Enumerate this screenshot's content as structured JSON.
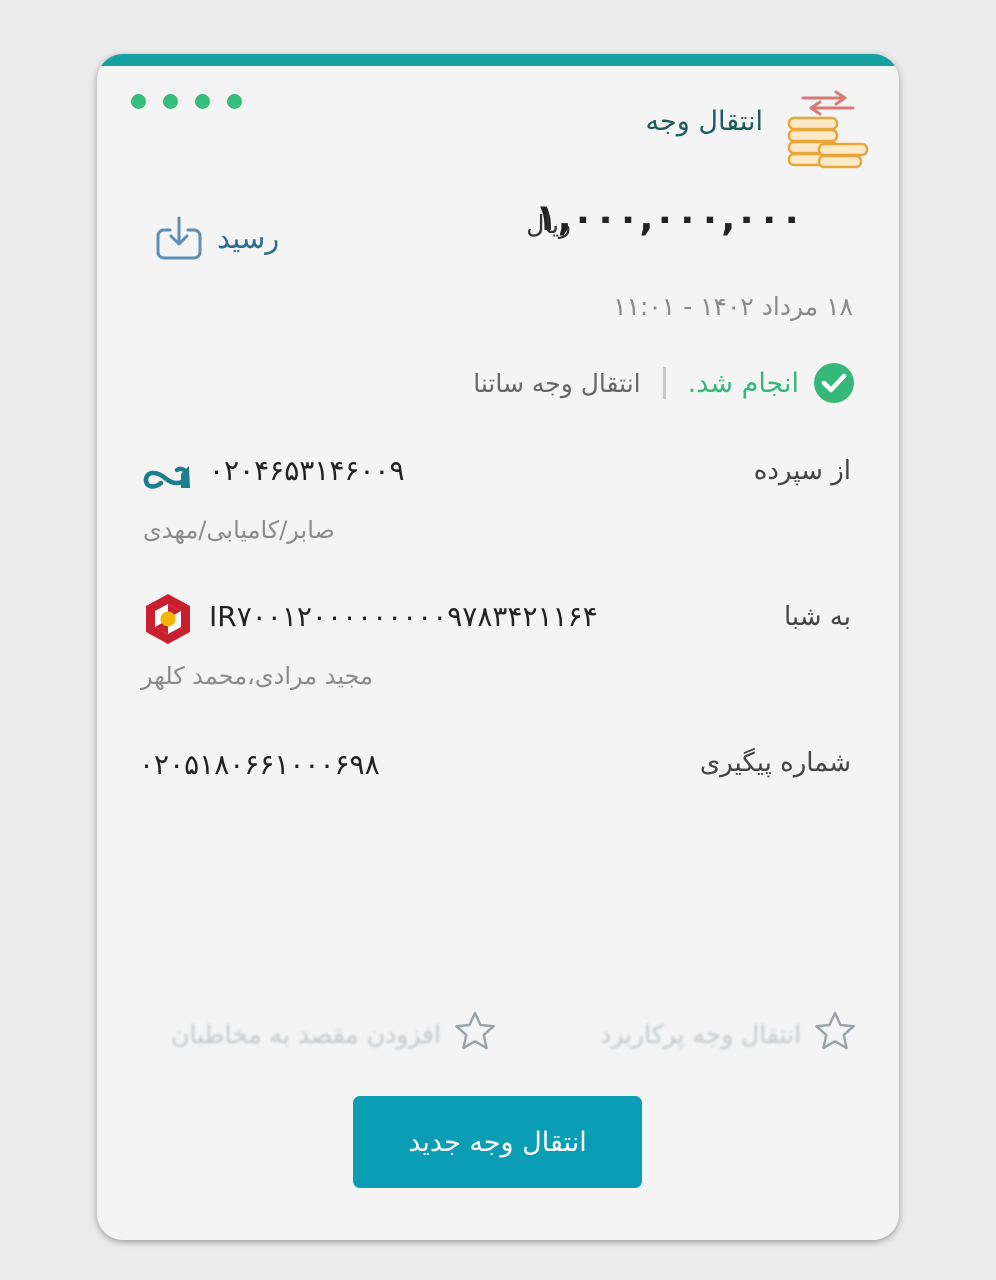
{
  "header": {
    "title": "انتقال وجه",
    "dot_count": 4
  },
  "transaction": {
    "amount": "۱,۰۰۰,۰۰۰,۰۰۰",
    "currency": "ریال",
    "receipt_label": "رسید",
    "datetime": "۱۸ مرداد ۱۴۰۲ - ۱۱:۰۱",
    "status_text": "انجام شد.",
    "type_text": "انتقال وجه ساتنا"
  },
  "from": {
    "label": "از سپرده",
    "account": "۰۲۰۴۶۵۳۱۴۶۰۰۹",
    "owner": "صابر/کامیابی/مهدی"
  },
  "to": {
    "label": "به شبا",
    "iban": "IR۷۰۰۱۲۰۰۰۰۰۰۰۰۰۹۷۸۳۴۲۱۱۶۴",
    "owner": "مجید مرادی،محمد کلهر"
  },
  "tracking": {
    "label": "شماره پیگیری",
    "number": "۰۲۰۵۱۸۰۶۶۱۰۰۰۶۹۸"
  },
  "favorites": {
    "frequent_label": "انتقال وجه پرکاربرد",
    "add_contact_label": "افزودن مقصد به مخاطبان"
  },
  "actions": {
    "new_transfer_label": "انتقال وجه جدید"
  },
  "colors": {
    "accent": "#17a1a3",
    "success": "#35b879",
    "button": "#0b9db3",
    "bank_logo": "#c8202f"
  }
}
